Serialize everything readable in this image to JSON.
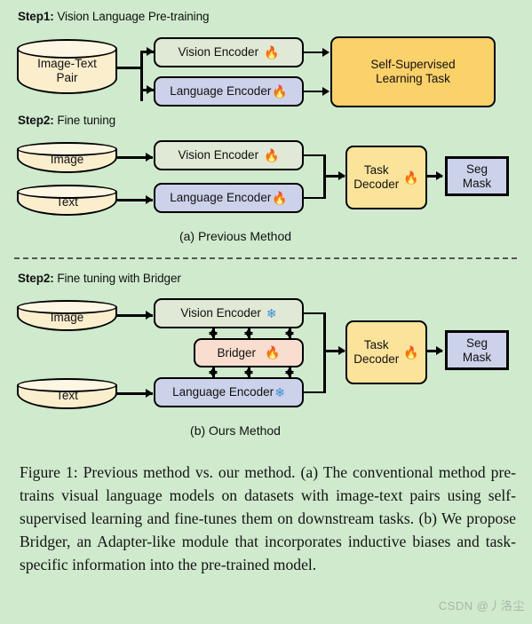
{
  "figure": {
    "background_color": "#cfeacd",
    "caption": "Figure 1: Previous method vs. our method. (a) The conventional method pre-trains visual language models on datasets with image-text pairs using self-supervised learning and fine-tunes them on downstream tasks. (b) We propose Bridger, an Adapter-like module that incorporates inductive biases and task-specific information into the pre-trained model.",
    "watermark": "CSDN @丿洛尘"
  },
  "panel_a": {
    "step1": {
      "label": "Step1:",
      "text": " Vision Language Pre-training"
    },
    "step2": {
      "label": "Step2:",
      "text": " Fine tuning"
    },
    "caption": "(a) Previous Method",
    "pretrain": {
      "source": "Image-Text\nPair",
      "vision_encoder": "Vision Encoder",
      "vision_encoder_icon": "fire-icon",
      "language_encoder": "Language Encoder",
      "language_encoder_icon": "fire-icon",
      "task": "Self-Supervised\nLearning Task"
    },
    "finetune": {
      "image_source": "Image",
      "text_source": "Text",
      "vision_encoder": "Vision Encoder",
      "vision_encoder_icon": "fire-icon",
      "language_encoder": "Language Encoder",
      "language_encoder_icon": "fire-icon",
      "decoder": "Task\nDecoder",
      "decoder_icon": "fire-icon",
      "output": "Seg\nMask"
    }
  },
  "panel_b": {
    "step2": {
      "label": "Step2:",
      "text": " Fine tuning with Bridger"
    },
    "caption": "(b) Ours Method",
    "finetune": {
      "image_source": "Image",
      "text_source": "Text",
      "vision_encoder": "Vision Encoder",
      "vision_encoder_icon": "snowflake-icon",
      "bridger": "Bridger",
      "bridger_icon": "fire-icon",
      "language_encoder": "Language Encoder",
      "language_encoder_icon": "snowflake-icon",
      "decoder": "Task\nDecoder",
      "decoder_icon": "fire-icon",
      "output": "Seg\nMask"
    }
  },
  "icons": {
    "fire": "🔥",
    "snowflake": "❄"
  },
  "colors": {
    "background": "#cfeacd",
    "vision_encoder": "#dfe9d5",
    "language_encoder": "#ccd2ea",
    "ssl_task": "#fbd169",
    "task_decoder": "#fbe49a",
    "seg_mask": "#ccd2ea",
    "bridger": "#f9ded0",
    "cylinder": "#fbeecd",
    "stroke": "#000000"
  }
}
